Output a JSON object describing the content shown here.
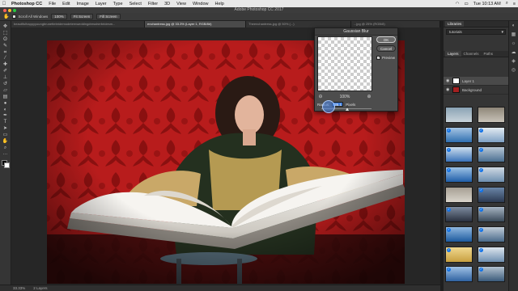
{
  "menubar": {
    "app_name": "Photoshop CC",
    "items": [
      "File",
      "Edit",
      "Image",
      "Layer",
      "Type",
      "Select",
      "Filter",
      "3D",
      "View",
      "Window",
      "Help"
    ],
    "time": "Tue 10:13 AM"
  },
  "window": {
    "title": "Adobe Photoshop CC 2017"
  },
  "options_bar": {
    "scroll_all_windows": "Scroll All Windows",
    "zoom_100": "100%",
    "fit_screen": "Fit Screen",
    "fill_screen": "Fill Screen"
  },
  "tabs": [
    "beautifulhappyyoungbrunettebridemodeternweddingdressherbridesm...",
    "enchantress.jpg @ 33.3% (Layer 1, RGB/8#)",
    "Theenchantress.jpg @ 50% (...)",
    "...jpg @ 25% (RGB/8)"
  ],
  "dialog": {
    "title": "Gaussian Blur",
    "ok_label": "OK",
    "cancel_label": "Cancel",
    "preview_label": "Preview",
    "zoom_level": "100%",
    "radius_label": "Radius:",
    "radius_value": "35.1",
    "radius_unit": "Pixels",
    "slider_value_fraction": 0.52
  },
  "panels": {
    "libraries_tab": "Libraries",
    "library_select": "tutorials",
    "layers_tab": "Layers",
    "channels_tab": "Channels",
    "paths_tab": "Paths",
    "layers": [
      {
        "name": "Layer 1",
        "selected": true
      },
      {
        "name": "Background",
        "selected": false
      }
    ],
    "preview_title": "Gaussian Blur"
  },
  "status": {
    "zoom": "33.33%",
    "layers": "2 Layers"
  },
  "colors": {
    "wallpaper": "#b81c1c",
    "wallpaper_dark": "#8a1010",
    "accent_blue": "#1473e6"
  },
  "tools": [
    "move-icon",
    "marquee-icon",
    "lasso-icon",
    "quick-select-icon",
    "crop-icon",
    "eyedropper-icon",
    "healing-icon",
    "brush-icon",
    "clone-stamp-icon",
    "history-brush-icon",
    "eraser-icon",
    "gradient-icon",
    "blur-icon",
    "dodge-icon",
    "pen-icon",
    "type-icon",
    "path-select-icon",
    "shape-icon",
    "hand-icon",
    "zoom-icon",
    "more-tools-icon"
  ],
  "stock_thumbnails": [
    {
      "checked": false
    },
    {
      "checked": false
    },
    {
      "checked": true
    },
    {
      "checked": true
    },
    {
      "checked": true
    },
    {
      "checked": true
    },
    {
      "checked": true
    },
    {
      "checked": true
    },
    {
      "checked": false
    },
    {
      "checked": true
    },
    {
      "checked": true
    },
    {
      "checked": true
    },
    {
      "checked": true
    },
    {
      "checked": true
    },
    {
      "checked": true
    },
    {
      "checked": true
    },
    {
      "checked": true
    },
    {
      "checked": true
    }
  ]
}
